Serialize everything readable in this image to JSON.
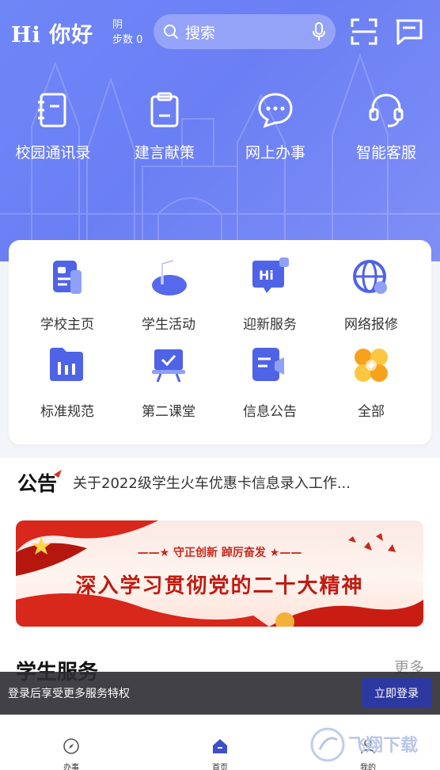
{
  "header": {
    "logo": "Hi 你好",
    "weather": "阴",
    "steps": "步数 0",
    "search_placeholder": "搜索"
  },
  "quick_actions": [
    {
      "label": "校园通讯录",
      "icon": "address-book-icon"
    },
    {
      "label": "建言献策",
      "icon": "clipboard-icon"
    },
    {
      "label": "网上办事",
      "icon": "chat-bubble-icon"
    },
    {
      "label": "智能客服",
      "icon": "headset-icon"
    }
  ],
  "grid": [
    {
      "label": "学校主页",
      "icon": "school-home-icon"
    },
    {
      "label": "学生活动",
      "icon": "music-note-icon"
    },
    {
      "label": "迎新服务",
      "icon": "hi-bubble-icon"
    },
    {
      "label": "网络报修",
      "icon": "globe-wrench-icon"
    },
    {
      "label": "标准规范",
      "icon": "folder-chart-icon"
    },
    {
      "label": "第二课堂",
      "icon": "easel-check-icon"
    },
    {
      "label": "信息公告",
      "icon": "megaphone-doc-icon"
    },
    {
      "label": "全部",
      "icon": "all-apps-icon"
    }
  ],
  "notice": {
    "tag": "公告",
    "text": "关于2022级学生火车优惠卡信息录入工作..."
  },
  "banner": {
    "motto": "——★ 守正创新  踔厉奋发 ★——",
    "headline": "深入学习贯彻党的二十大精神"
  },
  "services": {
    "title": "学生服务",
    "more": "更多"
  },
  "login_bar": {
    "message": "登录后享受更多服务特权",
    "button": "立即登录"
  },
  "tabs": [
    {
      "label": "办事",
      "icon": "compass-icon"
    },
    {
      "label": "首页",
      "icon": "home-icon"
    },
    {
      "label": "我的",
      "icon": "profile-icon"
    }
  ],
  "watermark": "飞翔下载",
  "colors": {
    "primary": "#6b7ff4",
    "accent_dark": "#2d39a0",
    "banner_red": "#c01b12"
  }
}
